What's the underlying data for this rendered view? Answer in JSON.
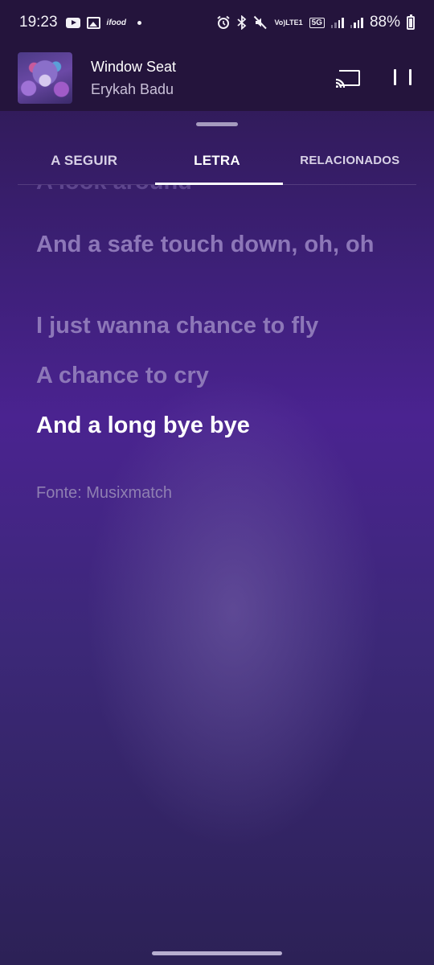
{
  "status_bar": {
    "time": "19:23",
    "notification_icons": [
      "youtube-icon",
      "gallery-icon",
      "ifood-icon",
      "dot-icon"
    ],
    "ifood_text": "ifood",
    "volte_label": "Vo)",
    "lte_label": "LTE1",
    "network_label": "5G",
    "battery": "88%"
  },
  "player": {
    "title": "Window Seat",
    "artist": "Erykah Badu"
  },
  "tabs": [
    {
      "label": "A SEGUIR",
      "active": false
    },
    {
      "label": "LETRA",
      "active": true
    },
    {
      "label": "RELACIONADOS",
      "active": false
    }
  ],
  "lyrics": {
    "lines": [
      {
        "text": "A look around",
        "state": "faded"
      },
      {
        "text": "And a safe touch down, oh, oh",
        "state": "past"
      },
      {
        "text": "I just wanna chance to fly",
        "state": "past"
      },
      {
        "text": "A chance to cry",
        "state": "past"
      },
      {
        "text": "And a long bye bye",
        "state": "current"
      }
    ],
    "source": "Fonte: Musixmatch"
  },
  "colors": {
    "background_top": "#2a1848",
    "background_mid": "#4a2390",
    "header": "#24143c",
    "lyric_inactive": "#8d77b8",
    "lyric_active": "#ffffff"
  }
}
